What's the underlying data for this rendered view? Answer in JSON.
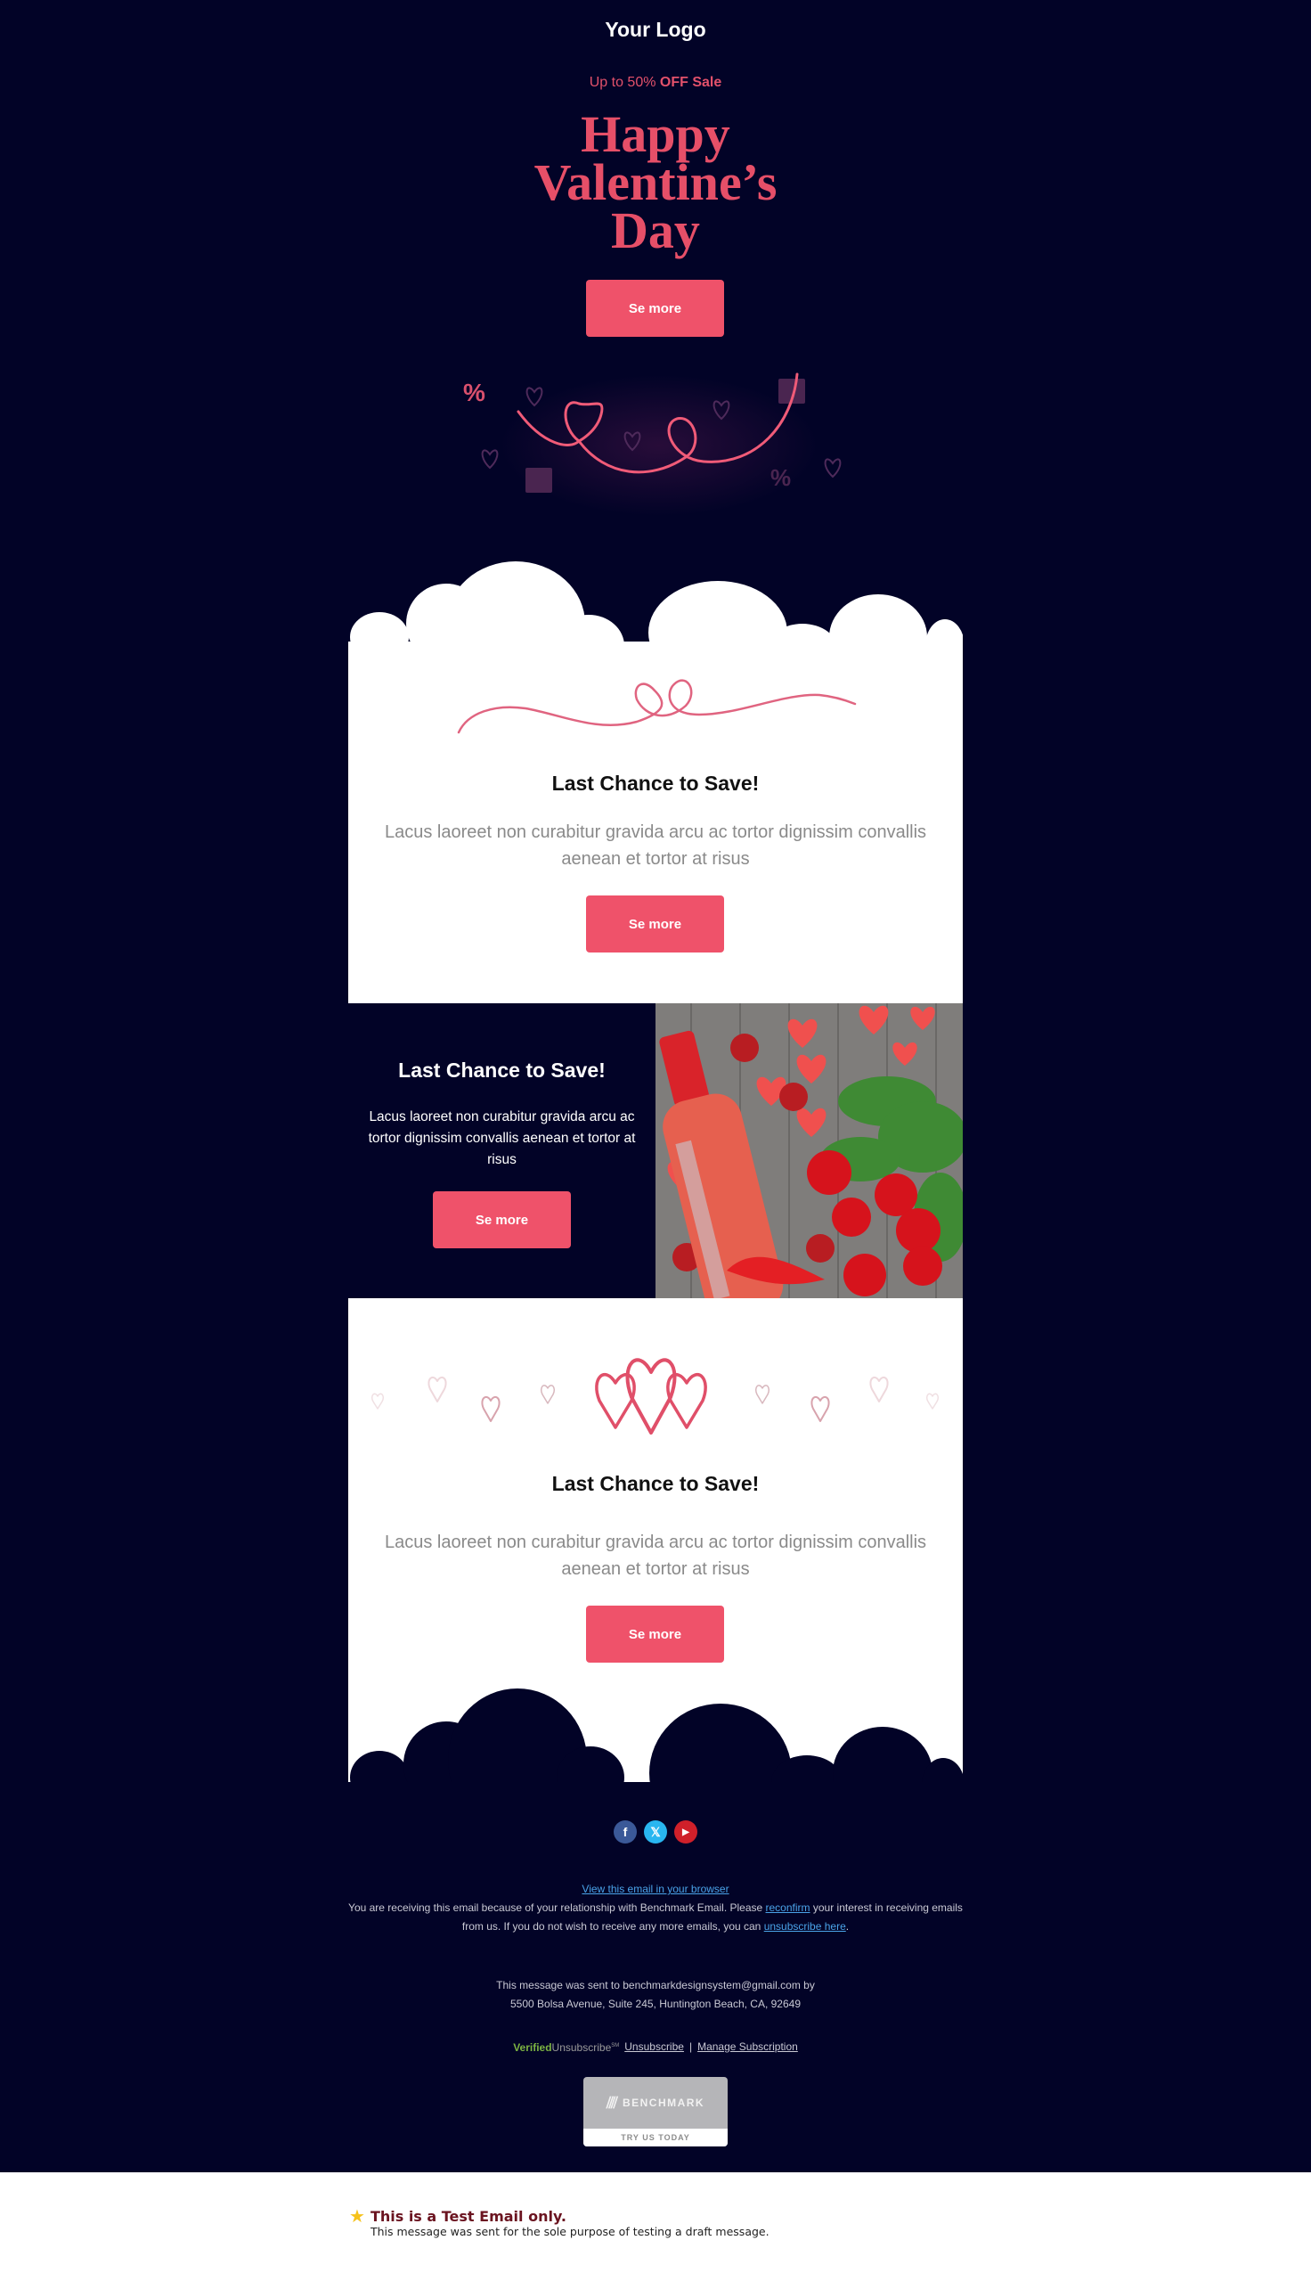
{
  "header": {
    "logo_text": "Your Logo",
    "promo_prefix": "Up to 50% ",
    "promo_bold": "OFF Sale",
    "hero_lines": [
      "Happy",
      "Valentine’s",
      "Day"
    ],
    "cta_label": "Se more"
  },
  "section1": {
    "heading": "Last Chance to Save!",
    "body": "Lacus laoreet non curabitur gravida arcu ac tortor dignissim convallis aenean et tortor at risus",
    "cta_label": "Se more"
  },
  "section2": {
    "heading": "Last Chance to Save!",
    "body": "Lacus laoreet non curabitur gravida arcu ac tortor dignissim convallis aenean et tortor at risus",
    "cta_label": "Se more",
    "image_alt": "Wine bottle with red roses, chocolates and paper hearts"
  },
  "section3": {
    "heading": "Last Chance to Save!",
    "body": "Lacus laoreet non curabitur gravida arcu ac tortor dignissim convallis aenean et tortor at risus",
    "cta_label": "Se more"
  },
  "footer": {
    "social": [
      {
        "name": "facebook",
        "glyph": "f",
        "color": "#3b5998"
      },
      {
        "name": "x-twitter",
        "glyph": "𝕏",
        "color": "#29b6f0"
      },
      {
        "name": "youtube",
        "glyph": "▶",
        "color": "#d0202a"
      }
    ],
    "view_in_browser": "View this email in your browser",
    "notice_part1": "You are receiving this email because of your relationship with Benchmark Email. Please ",
    "reconfirm_link": "reconfirm",
    "notice_part2": " your interest in receiving emails from us. If you do not wish to receive any more emails, you can ",
    "unsubscribe_here_link": "unsubscribe here",
    "notice_part3": ".",
    "sent_to_line": "This message was sent to benchmarkdesignsystem@gmail.com by",
    "address_line": "5500 Bolsa Avenue, Suite 245, Huntington Beach, CA, 92649",
    "verified_logo_a": "Verified",
    "verified_logo_b": "Unsubscribe",
    "verified_logo_sm": "SM",
    "unsubscribe_link": "Unsubscribe",
    "separator": "|",
    "manage_link": "Manage Subscription",
    "badge_brand": "BENCHMARK",
    "badge_cta": "TRY US TODAY"
  },
  "test_notice": {
    "title": "This is a Test Email only.",
    "subtitle": "This message was sent for the sole purpose of testing a draft message."
  },
  "colors": {
    "background": "#020327",
    "accent_pink": "#ef526a",
    "hero_pink": "#e64f68",
    "link_blue": "#4aa3e8"
  }
}
